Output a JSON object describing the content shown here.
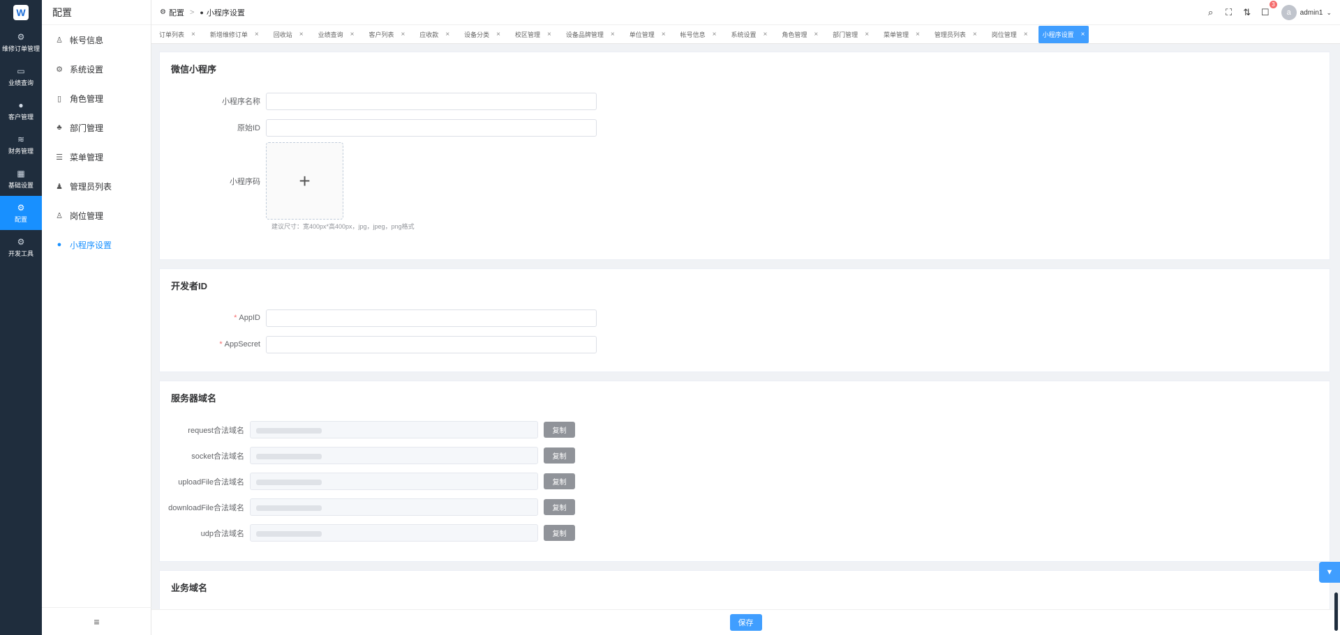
{
  "rail": {
    "logo": "W",
    "items": [
      {
        "label": "维修订单管理",
        "icon": "chip-icon"
      },
      {
        "label": "业绩查询",
        "icon": "chart-icon"
      },
      {
        "label": "客户管理",
        "icon": "user-icon"
      },
      {
        "label": "财务管理",
        "icon": "database-icon"
      },
      {
        "label": "基础设置",
        "icon": "grid-icon"
      },
      {
        "label": "配置",
        "icon": "gear-icon",
        "active": true
      },
      {
        "label": "开发工具",
        "icon": "gear-icon"
      }
    ]
  },
  "sidebar": {
    "title": "配置",
    "items": [
      {
        "label": "帐号信息",
        "icon": "user-icon"
      },
      {
        "label": "系统设置",
        "icon": "gear-icon"
      },
      {
        "label": "角色管理",
        "icon": "document-icon"
      },
      {
        "label": "部门管理",
        "icon": "org-icon"
      },
      {
        "label": "菜单管理",
        "icon": "list-icon"
      },
      {
        "label": "管理员列表",
        "icon": "user-icon"
      },
      {
        "label": "岗位管理",
        "icon": "user-icon"
      },
      {
        "label": "小程序设置",
        "icon": "wechat-icon",
        "active": true
      }
    ],
    "collapse_icon": "hamburger-icon"
  },
  "header": {
    "breadcrumb": [
      "配置",
      "小程序设置"
    ],
    "notify_count": "3",
    "avatar_letter": "a",
    "username": "admin1"
  },
  "tabs": [
    "订单列表",
    "新增维修订单",
    "回收站",
    "业绩查询",
    "客户列表",
    "应收款",
    "设备分类",
    "校区管理",
    "设备品牌管理",
    "单位管理",
    "帐号信息",
    "系统设置",
    "角色管理",
    "部门管理",
    "菜单管理",
    "管理员列表",
    "岗位管理",
    "小程序设置"
  ],
  "active_tab": "小程序设置",
  "wechat_section": {
    "title": "微信小程序",
    "name_label": "小程序名称",
    "name_value": "",
    "origin_id_label": "原始ID",
    "origin_id_value": "",
    "qrcode_label": "小程序码",
    "upload_glyph": "+",
    "hint": "建议尺寸：宽400px*高400px，jpg，jpeg，png格式"
  },
  "developer_section": {
    "title": "开发者ID",
    "required_mark": "*",
    "appid_label": "AppID",
    "appid_value": "",
    "appsecret_label": "AppSecret",
    "appsecret_value": ""
  },
  "server_section": {
    "title": "服务器域名",
    "copy_label": "复制",
    "rows": [
      {
        "label": "request合法域名"
      },
      {
        "label": "socket合法域名"
      },
      {
        "label": "uploadFile合法域名"
      },
      {
        "label": "downloadFile合法域名"
      },
      {
        "label": "udp合法域名"
      }
    ]
  },
  "business_section": {
    "title": "业务域名"
  },
  "footer": {
    "save_label": "保存"
  }
}
